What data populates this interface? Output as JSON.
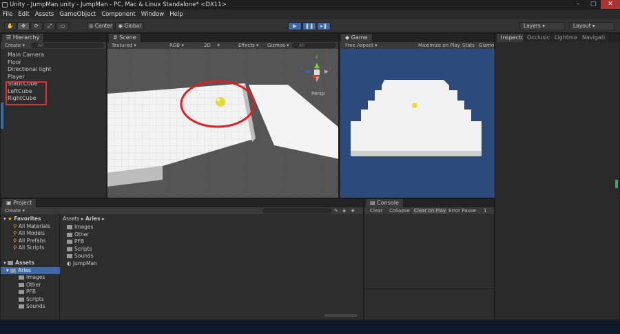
{
  "window": {
    "title": "Unity - JumpMan.unity - JumpMan - PC, Mac & Linux Standalone* <DX11>"
  },
  "menu": [
    "File",
    "Edit",
    "Assets",
    "GameObject",
    "Component",
    "Window",
    "Help"
  ],
  "toolbar": {
    "center": "Center",
    "global": "Global",
    "layers": "Layers",
    "layout": "Layout"
  },
  "hierarchy": {
    "tab": "Hierarchy",
    "create": "Create",
    "search": "All",
    "items": [
      "Main Camera",
      "Floor",
      "Directional light",
      "Player",
      "StaticCube",
      "LeftCube",
      "RightCube"
    ]
  },
  "scene": {
    "tab": "Scene",
    "shading": "Textured",
    "render": "RGB",
    "mode_2d": "2D",
    "effects": "Effects",
    "gizmos": "Gizmos",
    "search": "All",
    "gizmo_axes": {
      "y": "y",
      "x": "x",
      "z": "z"
    },
    "persp": "Persp"
  },
  "game": {
    "tab": "Game",
    "aspect": "Free Aspect",
    "maximize": "Maximize on Play",
    "stats": "Stats",
    "gizmos": "Gizmo"
  },
  "inspector": {
    "tabs": [
      "Inspector",
      "Occlusic",
      "Lightma",
      "Navigati"
    ]
  },
  "project": {
    "tab": "Project",
    "create": "Create",
    "favorites_label": "Favorites",
    "favorites": [
      "All Materials",
      "All Models",
      "All Prefabs",
      "All Scripts"
    ],
    "assets_label": "Assets",
    "selected_folder": "Aries",
    "folders": [
      "Images",
      "Other",
      "PFB",
      "Scripts",
      "Sounds"
    ],
    "breadcrumb": [
      "Assets",
      "Aries"
    ],
    "grid_items": [
      "Images",
      "Other",
      "PFB",
      "Scripts",
      "Sounds",
      "JumpMan"
    ]
  },
  "console": {
    "tab": "Console",
    "buttons": [
      "Clear",
      "Collapse",
      "Clear on Play",
      "Error Pause"
    ]
  },
  "colors": {
    "accent": "#3d6aa6",
    "annotation": "#e03030",
    "game_bg": "#2c4a7c"
  }
}
